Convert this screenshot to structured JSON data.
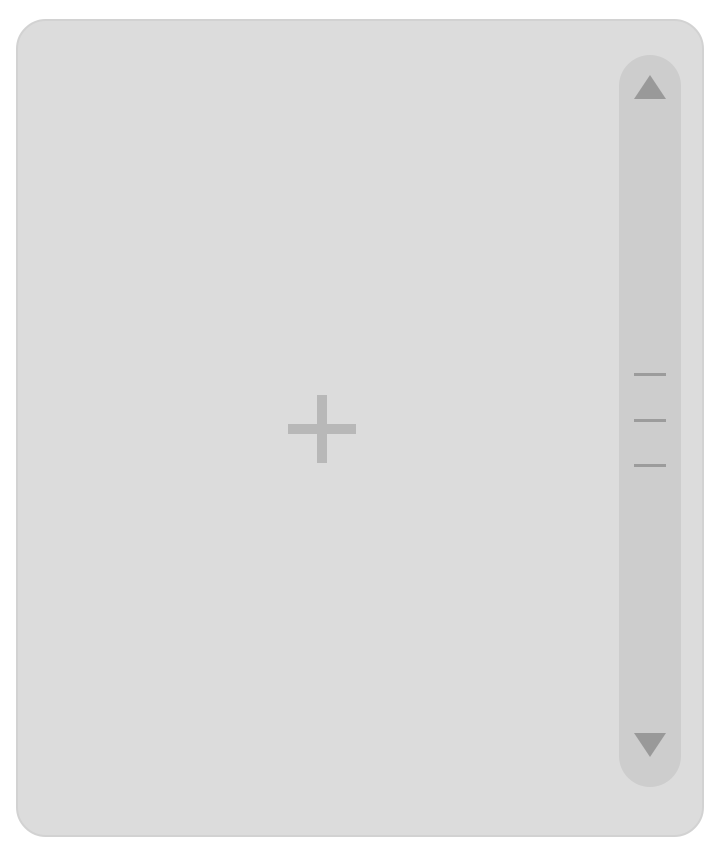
{
  "panel": {
    "background": "#dcdcdc",
    "add_icon": "plus-icon",
    "add_icon_color": "#b8b8b8"
  },
  "scrollbar": {
    "track_color": "#cdcdcd",
    "arrow_color": "#999999",
    "up_icon": "triangle-up-icon",
    "down_icon": "triangle-down-icon",
    "grip_icon": "grip-lines-icon"
  }
}
